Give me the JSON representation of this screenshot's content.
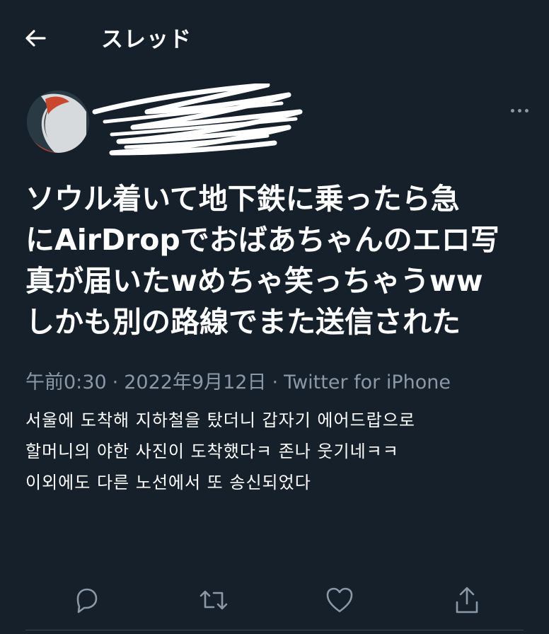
{
  "header": {
    "back_icon": "arrow-left-icon",
    "title": "スレッド"
  },
  "tweet": {
    "text_lines": [
      "ソウル着いて地下鉄に乗ったら急",
      "にAirDropでおばあちゃんのエロ写",
      "真が届いたwめちゃ笑っちゃうww",
      "しかも別の路線でまた送信された"
    ],
    "time": "午前0:30",
    "date": "2022年9月12日",
    "separator": "·",
    "source": "Twitter for iPhone"
  },
  "translation": {
    "lines": [
      "서울에 도착해 지하철을 탔더니 갑자기 에어드랍으로",
      "할머니의 야한 사진이 도착했다ㅋ 존나 웃기네ㅋㅋ",
      "이외에도 다른 노선에서 또 송신되었다"
    ]
  },
  "actions": {
    "reply_icon": "reply-icon",
    "retweet_icon": "retweet-icon",
    "like_icon": "heart-icon",
    "share_icon": "share-icon"
  },
  "colors": {
    "background": "#15202b",
    "text": "#ffffff",
    "secondary": "#8b98a5",
    "divider": "#38444d"
  }
}
